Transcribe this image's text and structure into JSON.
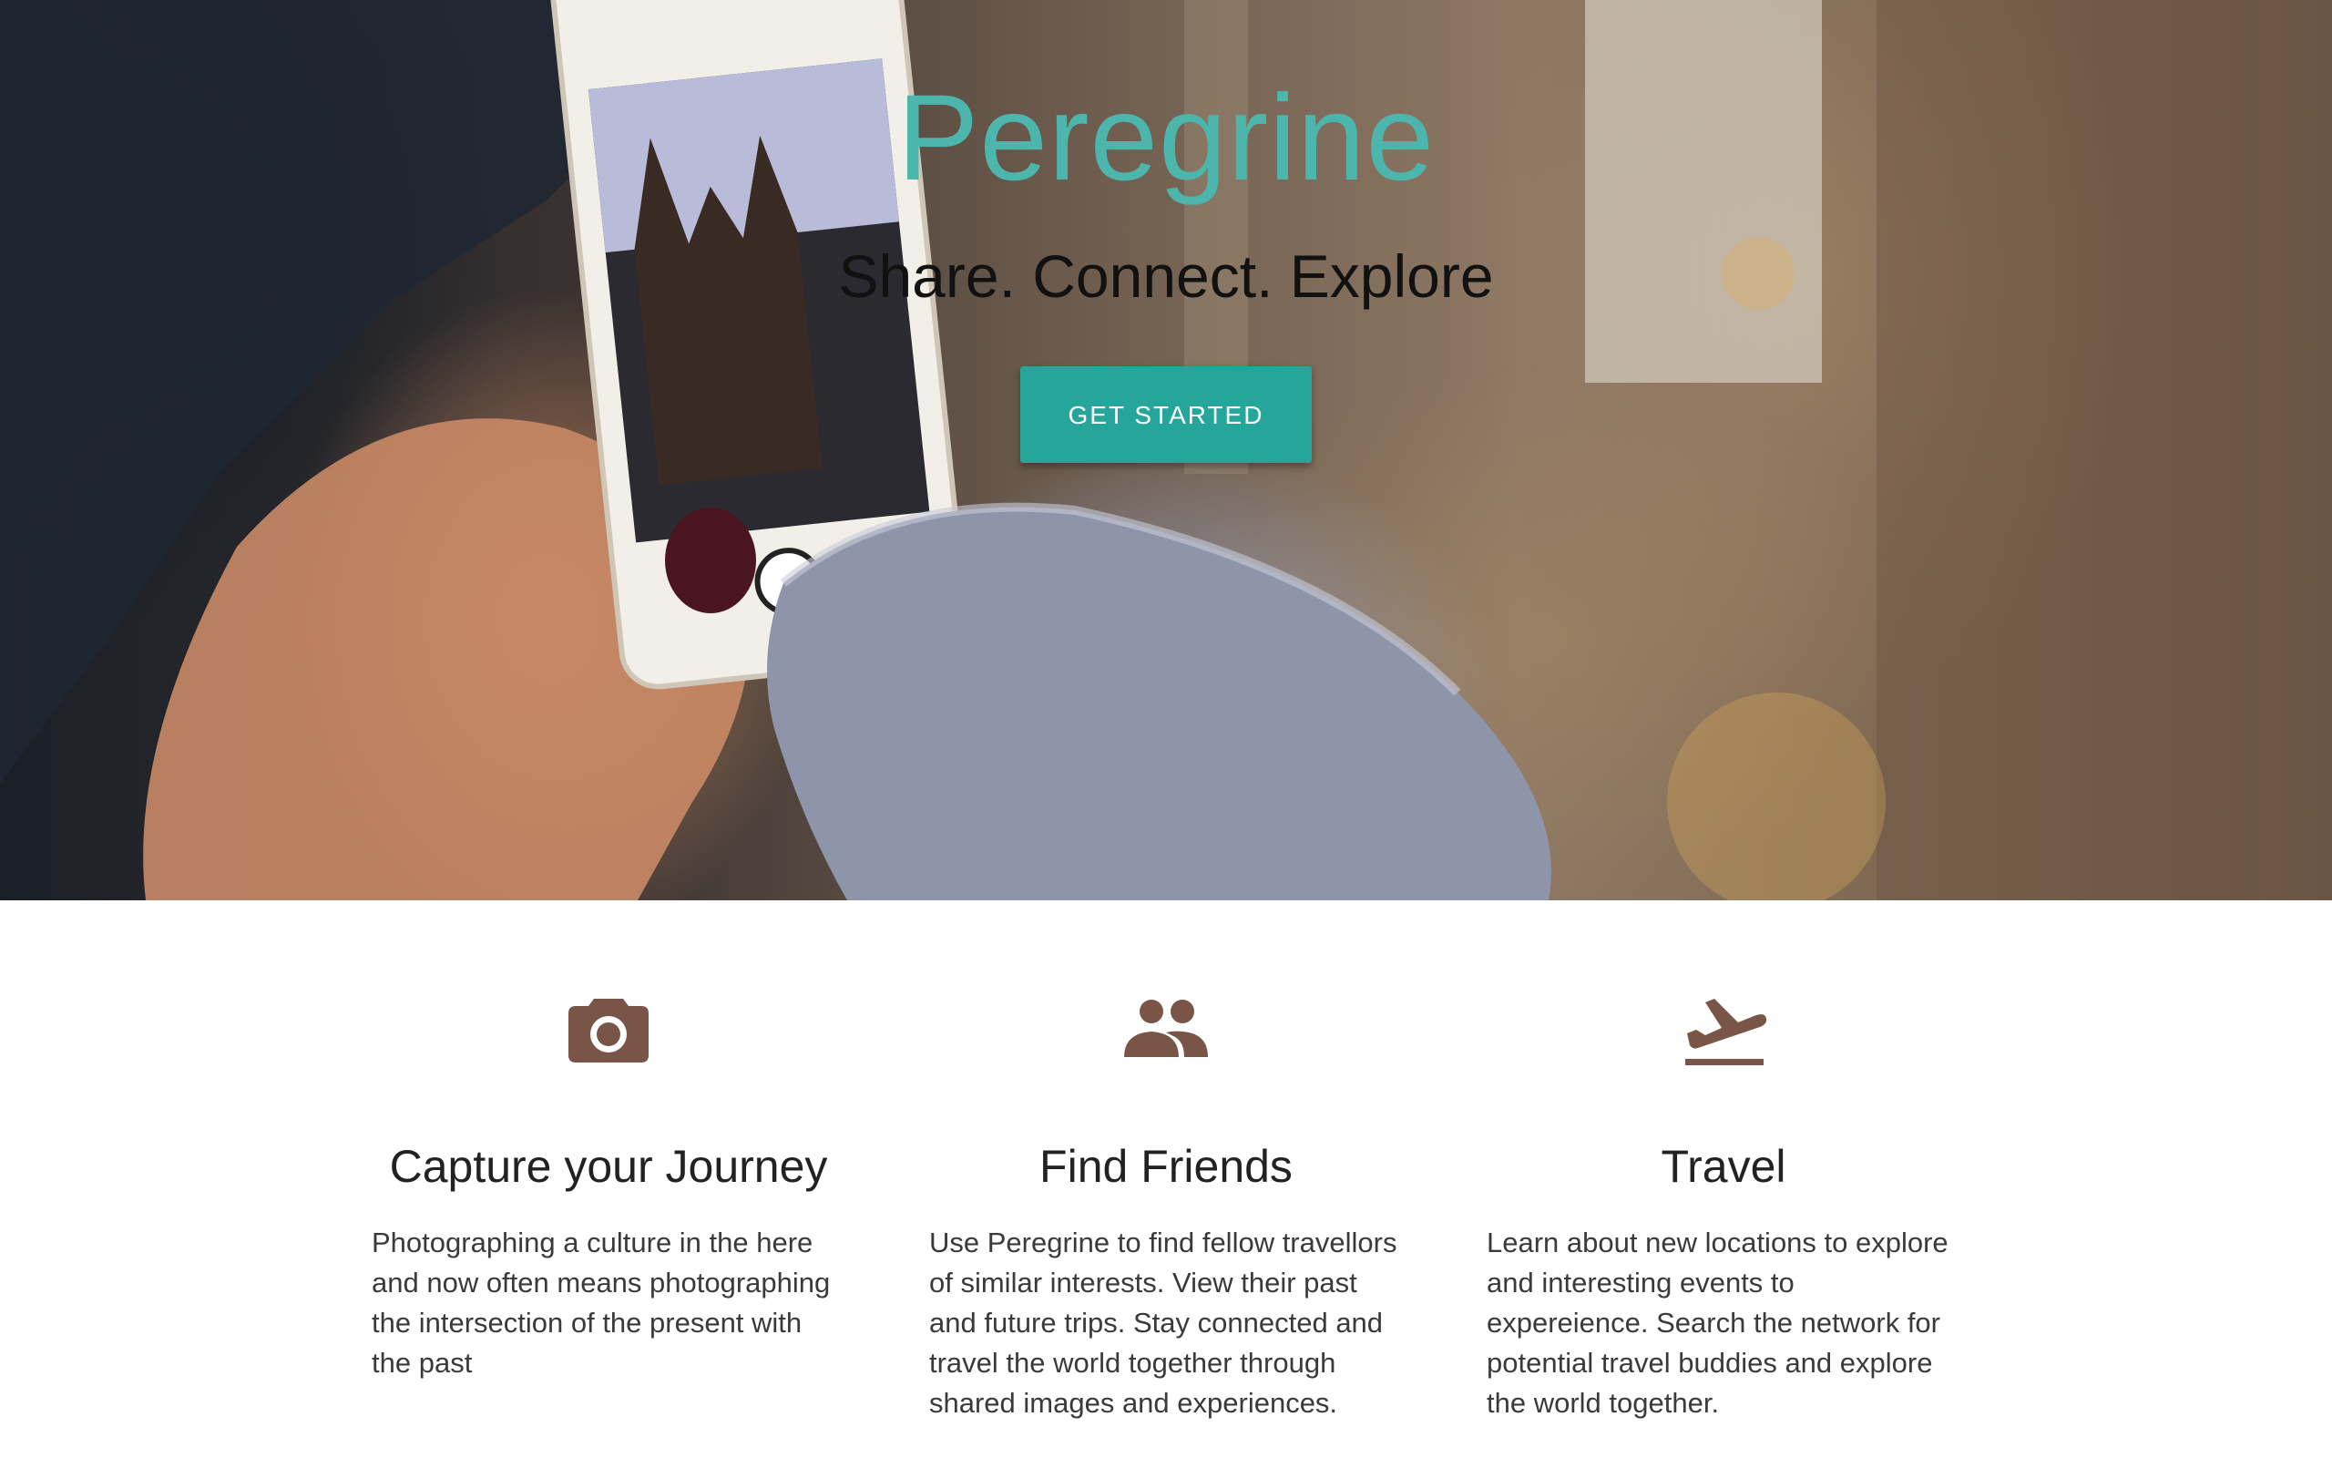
{
  "hero": {
    "title": "Peregrine",
    "tagline": "Share. Connect. Explore",
    "cta_label": "GET STARTED"
  },
  "features": [
    {
      "icon": "camera-icon",
      "title": "Capture your Journey",
      "text": "Photographing a culture in the here and now often means photographing the intersection of the present with the past"
    },
    {
      "icon": "people-icon",
      "title": "Find Friends",
      "text": "Use Peregrine to find fellow travellors of similar interests. View their past and future trips. Stay connected and travel the world together through shared images and experiences."
    },
    {
      "icon": "flight-takeoff-icon",
      "title": "Travel",
      "text": "Learn about new locations to explore and interesting events to expereience. Search the network for potential travel buddies and explore the world together."
    }
  ],
  "colors": {
    "accent": "#4db6ac",
    "button": "#26a69a",
    "icon": "#795548"
  }
}
